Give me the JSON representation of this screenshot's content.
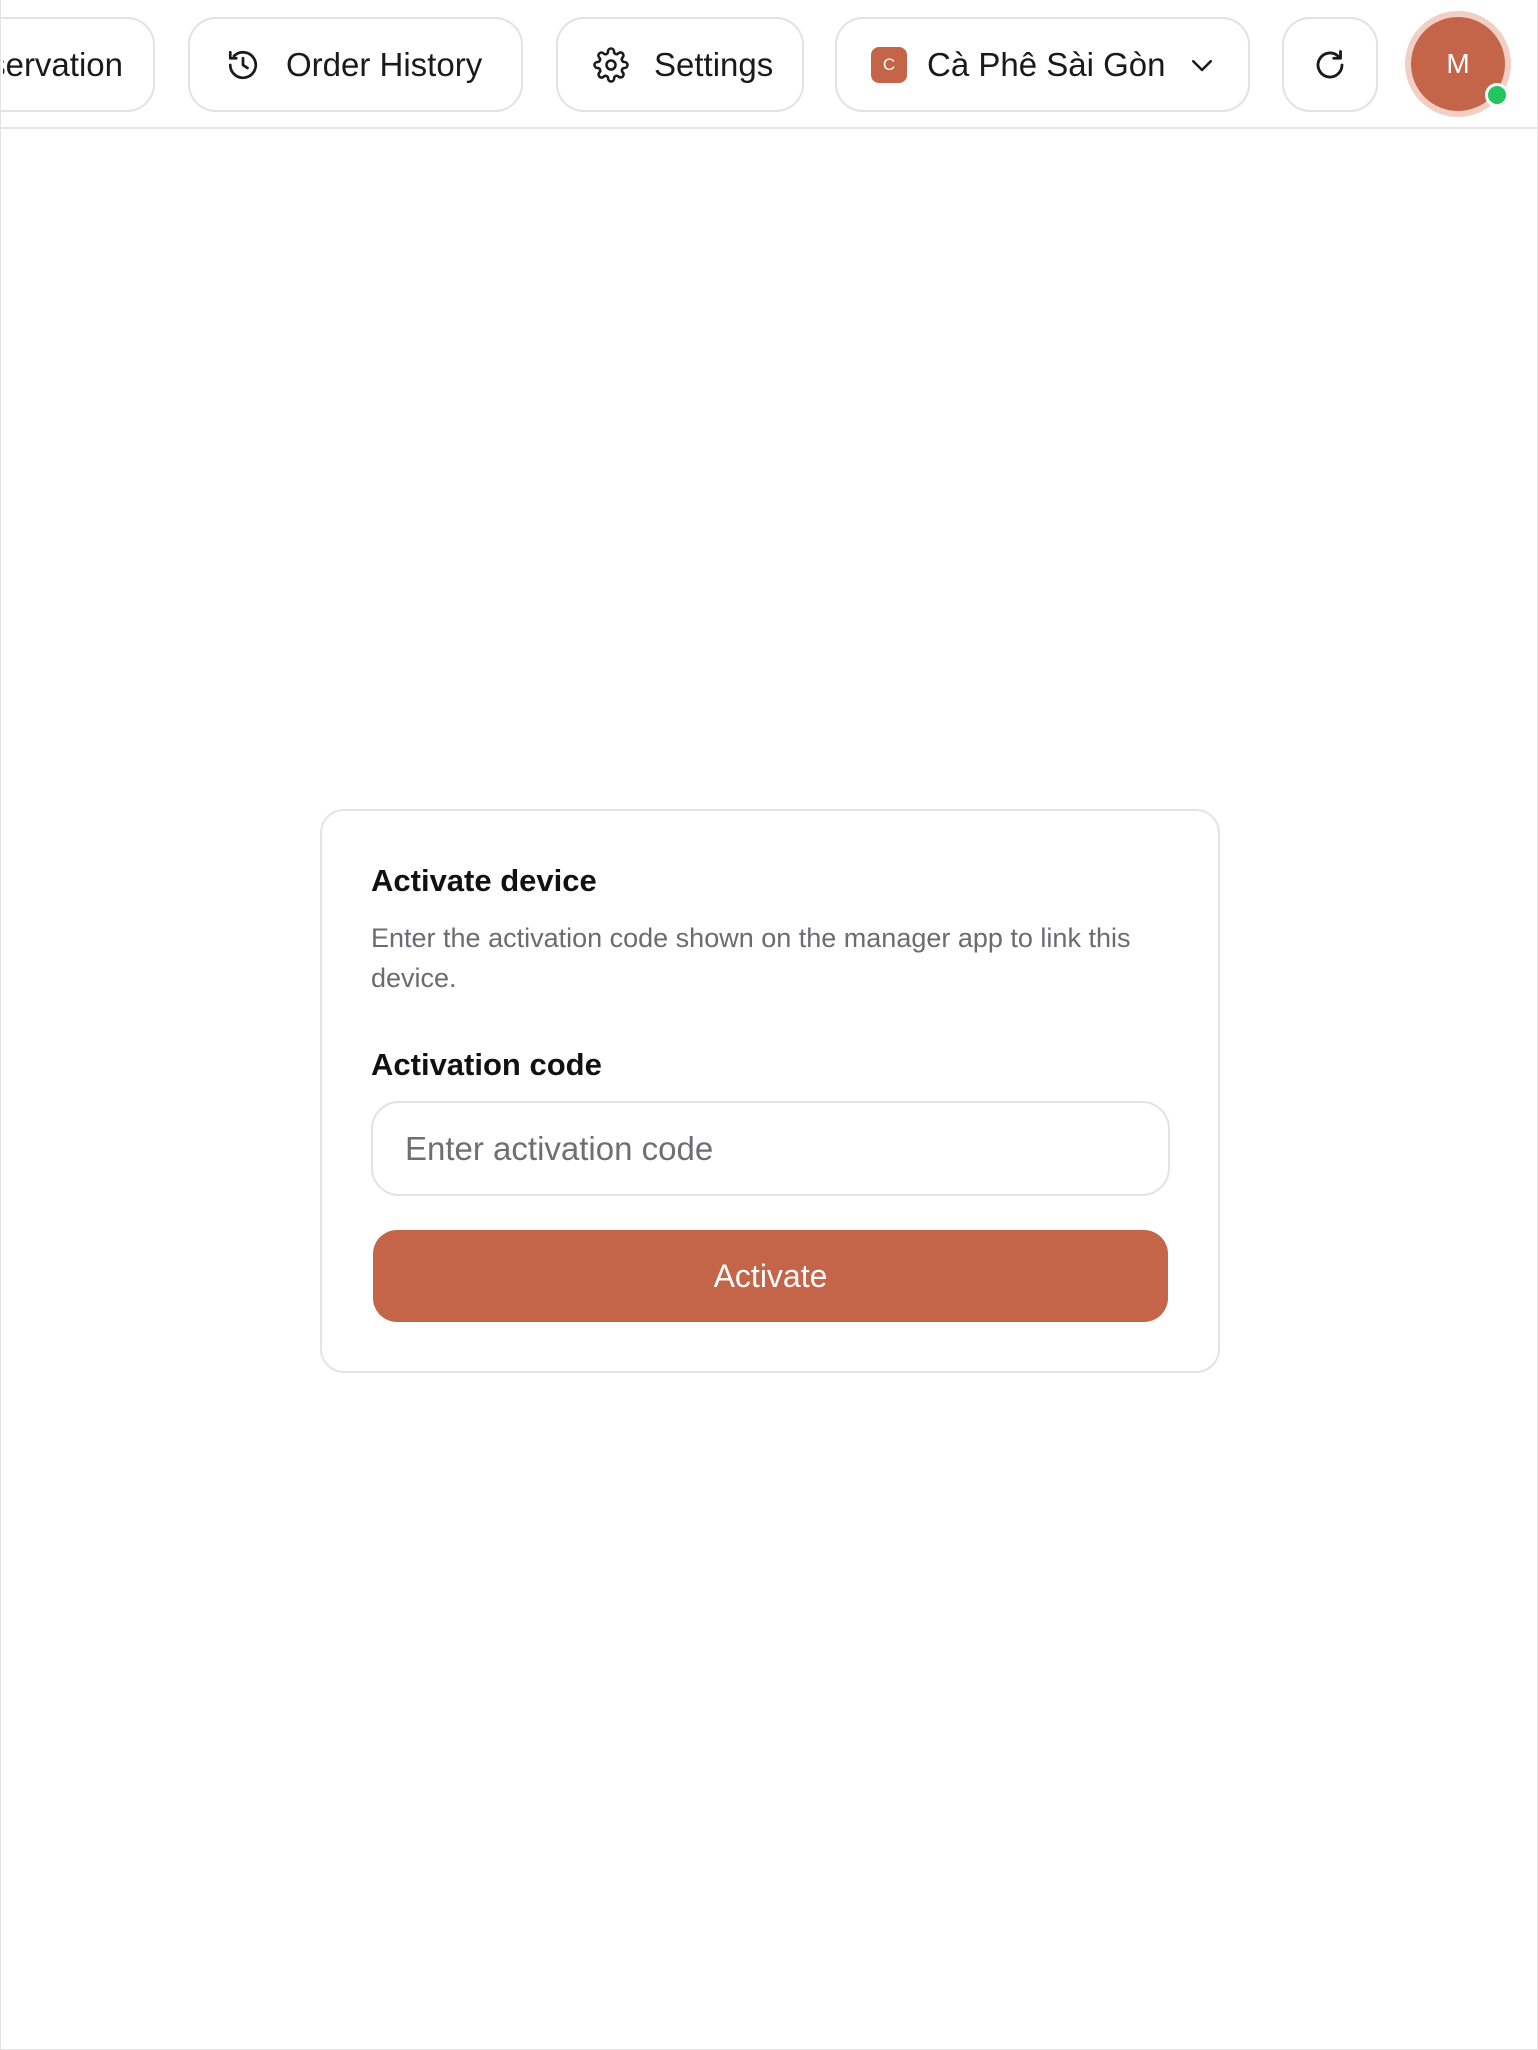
{
  "topbar": {
    "reservation_label": "Reservation",
    "order_history_label": "Order History",
    "settings_label": "Settings",
    "store": {
      "badge_letter": "C",
      "name": "Cà Phê Sài Gòn"
    },
    "user_initial": "M",
    "online": true
  },
  "icons": {
    "order_history": "history-clock-icon",
    "settings": "gear-icon",
    "store_dropdown": "chevron-down-icon",
    "refresh": "refresh-icon"
  },
  "activation": {
    "title": "Activate device",
    "description": "Enter the activation code shown on the manager app to link this device.",
    "field_label": "Activation code",
    "input_placeholder": "Enter activation code",
    "input_value": "",
    "button_label": "Activate"
  },
  "colors": {
    "accent": "#c4654a",
    "avatar_ring": "#f2cfc4",
    "online_status": "#22c55e",
    "muted_text": "#6b6b72",
    "border": "#e2e2e2"
  }
}
